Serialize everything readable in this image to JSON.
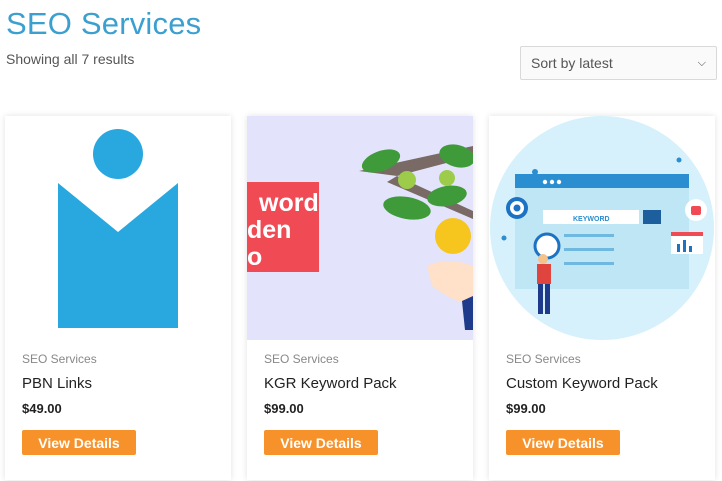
{
  "header": {
    "title": "SEO Services",
    "result_count": "Showing all 7 results"
  },
  "sort": {
    "selected": "Sort by latest"
  },
  "products": [
    {
      "category": "SEO Services",
      "title": "PBN Links",
      "price": "$49.00",
      "button_label": "View Details"
    },
    {
      "category": "SEO Services",
      "title": "KGR Keyword Pack",
      "price": "$99.00",
      "button_label": "View Details",
      "image_text_lines": [
        "word",
        "den",
        "o"
      ]
    },
    {
      "category": "SEO Services",
      "title": "Custom Keyword Pack",
      "price": "$99.00",
      "button_label": "View Details",
      "image_keyword_label": "KEYWORD"
    }
  ],
  "colors": {
    "title_blue": "#3b9fd0",
    "logo_blue": "#29a8e0",
    "button_orange": "#f7922a"
  }
}
